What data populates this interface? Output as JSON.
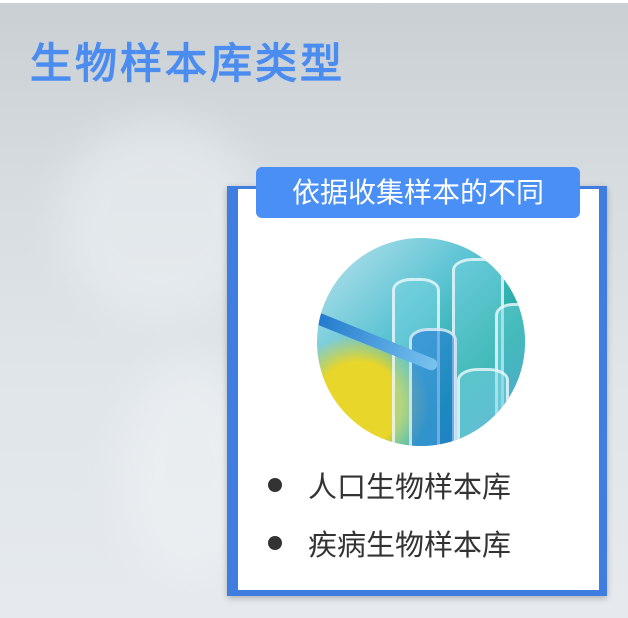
{
  "slide": {
    "title": "生物样本库类型",
    "card": {
      "label": "依据收集样本的不同",
      "image": "test-tubes-photo",
      "items": [
        "人口生物样本库",
        "疾病生物样本库"
      ]
    },
    "colors": {
      "accent": "#4a8cf0",
      "frame": "#3f7ee0",
      "text": "#333333"
    }
  }
}
